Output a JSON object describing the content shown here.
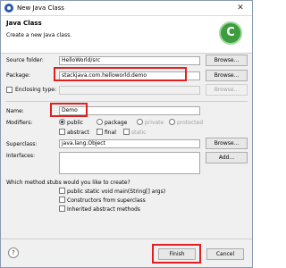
{
  "window": {
    "title": "New Java Class",
    "close_glyph": "✕"
  },
  "header": {
    "title": "Java Class",
    "description": "Create a new Java class.",
    "icon": "java-class-wizard-icon",
    "icon_glyph": "C"
  },
  "source_folder": {
    "label": "Source folder:",
    "value": "HelloWorld/src",
    "browse": "Browse..."
  },
  "package": {
    "label": "Package:",
    "value": "stackjava.com.helloworld.demo",
    "browse": "Browse..."
  },
  "enclosing": {
    "label": "Enclosing type:",
    "value": "",
    "browse": "Browse..."
  },
  "name": {
    "label": "Name:",
    "value": "Demo"
  },
  "modifiers": {
    "label": "Modifiers:",
    "options": [
      "public",
      "package",
      "private",
      "protected"
    ],
    "selected": "public",
    "checks": [
      "abstract",
      "final",
      "static"
    ]
  },
  "superclass": {
    "label": "Superclass:",
    "value": "java.lang.Object",
    "browse": "Browse..."
  },
  "interfaces": {
    "label": "Interfaces:",
    "add": "Add..."
  },
  "stubs": {
    "question": "Which method stubs would you like to create?",
    "options": [
      "public static void main(String[] args)",
      "Constructors from superclass",
      "Inherited abstract methods"
    ]
  },
  "footer": {
    "help": "?",
    "finish": "Finish",
    "cancel": "Cancel"
  },
  "colors": {
    "highlight": "#e02020",
    "accent": "#2f5aa8",
    "wizard_icon": "#3d9c3d"
  }
}
